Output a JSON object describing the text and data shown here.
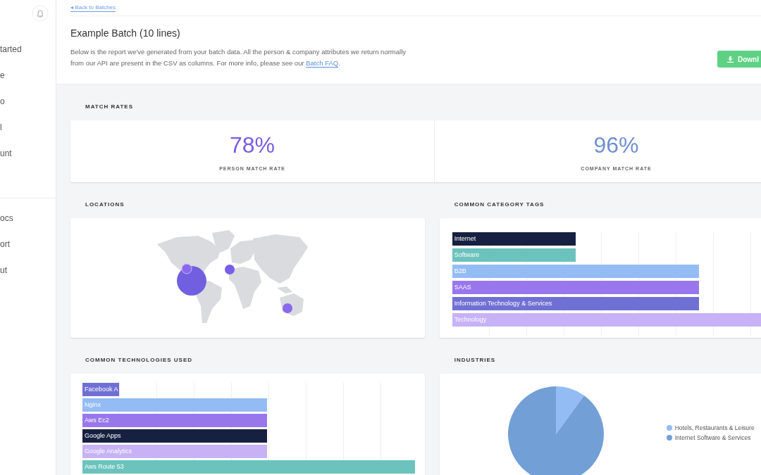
{
  "sidebar": {
    "items": [
      {
        "label": "tarted"
      },
      {
        "label": "e"
      },
      {
        "label": "o"
      },
      {
        "label": "l"
      },
      {
        "label": "unt"
      }
    ],
    "bottom_items": [
      {
        "label": "ocs"
      },
      {
        "label": "ort"
      },
      {
        "label": "ut"
      }
    ]
  },
  "header": {
    "back_link": "◂ Back to Batches",
    "title": "Example Batch (10 lines)",
    "description": "Below is the report we've generated from your batch data. All the person & company attributes we return normally from our API are present in the CSV as columns. For more info, please see our ",
    "faq_link": "Batch FAQ",
    "description_end": ".",
    "download_button": "Downl"
  },
  "match_rates": {
    "title": "MATCH RATES",
    "items": [
      {
        "value": "78%",
        "label": "PERSON MATCH RATE",
        "color": "#7b5ce0"
      },
      {
        "value": "96%",
        "label": "COMPANY MATCH RATE",
        "color": "#6f8fcf"
      }
    ]
  },
  "locations": {
    "title": "LOCATIONS"
  },
  "category_tags": {
    "title": "COMMON CATEGORY TAGS",
    "bars": [
      {
        "label": "Internet",
        "level": 0.333,
        "color": "#162040"
      },
      {
        "label": "Software",
        "level": 0.333,
        "color": "#6cc3bd"
      },
      {
        "label": "B2B",
        "level": 0.667,
        "color": "#93bcf4"
      },
      {
        "label": "SAAS",
        "level": 0.667,
        "color": "#9877ec"
      },
      {
        "label": "Information Technology & Services",
        "level": 0.667,
        "color": "#7070d4"
      },
      {
        "label": "Technology",
        "level": 1.0,
        "color": "#c6b2f5"
      }
    ]
  },
  "technologies": {
    "title": "COMMON TECHNOLOGIES USED",
    "bars": [
      {
        "label": "Facebook A",
        "level": 0.111,
        "color": "#7070d4"
      },
      {
        "label": "Nginx",
        "level": 0.556,
        "color": "#93bcf4"
      },
      {
        "label": "Aws Ec2",
        "level": 0.556,
        "color": "#9877ec"
      },
      {
        "label": "Google Apps",
        "level": 0.556,
        "color": "#162040"
      },
      {
        "label": "Google Analytics",
        "level": 0.556,
        "color": "#c6b2f5"
      },
      {
        "label": "Aws Route 53",
        "level": 1.0,
        "color": "#6cc3bd"
      }
    ]
  },
  "industries": {
    "title": "INDUSTRIES",
    "legend": [
      {
        "label": "Hotels, Restaurants & Leisure",
        "color": "#93bcf4"
      },
      {
        "label": "Internet Software & Services",
        "color": "#729fd6"
      }
    ]
  }
}
